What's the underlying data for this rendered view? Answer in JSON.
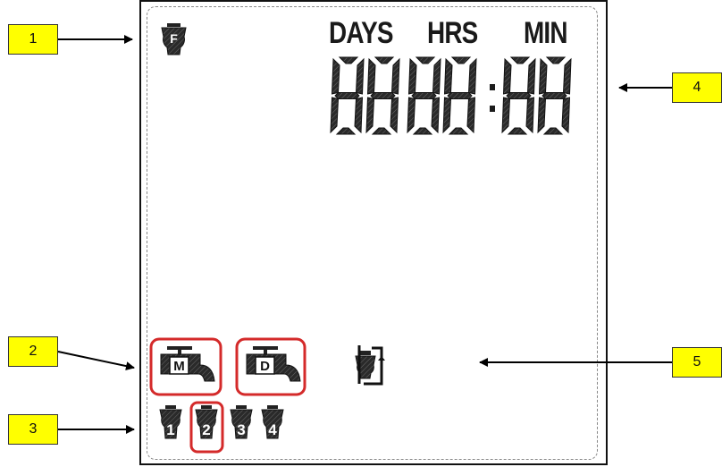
{
  "callouts": [
    {
      "number": "1"
    },
    {
      "number": "2"
    },
    {
      "number": "3"
    },
    {
      "number": "4"
    },
    {
      "number": "5"
    }
  ],
  "display": {
    "units": {
      "days": "DAYS",
      "hrs": "HRS",
      "min": "MIN"
    },
    "digits": "8888:88",
    "filter_letter": "F",
    "manual_letter": "M",
    "delay_letter": "D",
    "cylinders": [
      "1",
      "2",
      "3",
      "4"
    ]
  },
  "colors": {
    "callout_fill": "#ffff00",
    "highlight": "#d42a2a",
    "segment": "#1c1c1c"
  }
}
